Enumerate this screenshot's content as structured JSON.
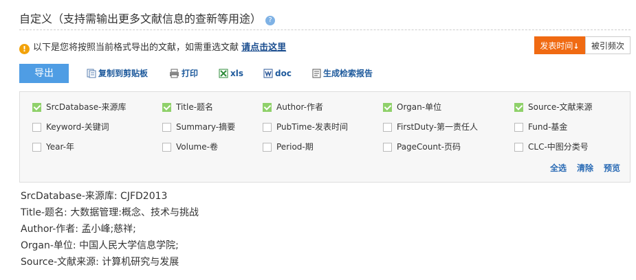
{
  "header": {
    "title": "自定义（支持需输出更多文献信息的查新等用途）",
    "help_glyph": "?"
  },
  "notice": {
    "icon_glyph": "!",
    "text": "以下是您将按照当前格式导出的文献，如需重选文献",
    "link": "请点击这里"
  },
  "sort": {
    "active_label": "发表时间",
    "active_arrow": "↓",
    "other_label": "被引频次"
  },
  "toolbar": {
    "export_label": "导出",
    "copy_label": "复制到剪贴板",
    "print_label": "打印",
    "xls_label": "xls",
    "doc_label": "doc",
    "report_label": "生成检索报告"
  },
  "fields": [
    {
      "label": "SrcDatabase-来源库",
      "checked": true
    },
    {
      "label": "Title-题名",
      "checked": true
    },
    {
      "label": "Author-作者",
      "checked": true
    },
    {
      "label": "Organ-单位",
      "checked": true
    },
    {
      "label": "Source-文献来源",
      "checked": true
    },
    {
      "label": "Keyword-关键词",
      "checked": false
    },
    {
      "label": "Summary-摘要",
      "checked": false
    },
    {
      "label": "PubTime-发表时间",
      "checked": false
    },
    {
      "label": "FirstDuty-第一责任人",
      "checked": false
    },
    {
      "label": "Fund-基金",
      "checked": false
    },
    {
      "label": "Year-年",
      "checked": false
    },
    {
      "label": "Volume-卷",
      "checked": false
    },
    {
      "label": "Period-期",
      "checked": false
    },
    {
      "label": "PageCount-页码",
      "checked": false
    },
    {
      "label": "CLC-中图分类号",
      "checked": false
    }
  ],
  "panel_actions": {
    "select_all": "全选",
    "clear": "清除",
    "preview": "预览"
  },
  "preview": [
    "SrcDatabase-来源库: CJFD2013",
    "Title-题名: 大数据管理:概念、技术与挑战",
    "Author-作者: 孟小峰;慈祥;",
    "Organ-单位: 中国人民大学信息学院;",
    "Source-文献来源: 计算机研究与发展"
  ],
  "colors": {
    "accent_orange": "#f06a12",
    "export_blue": "#4f9de4",
    "link_blue": "#1e5a9c",
    "checkbox_green": "#8fd16a"
  }
}
